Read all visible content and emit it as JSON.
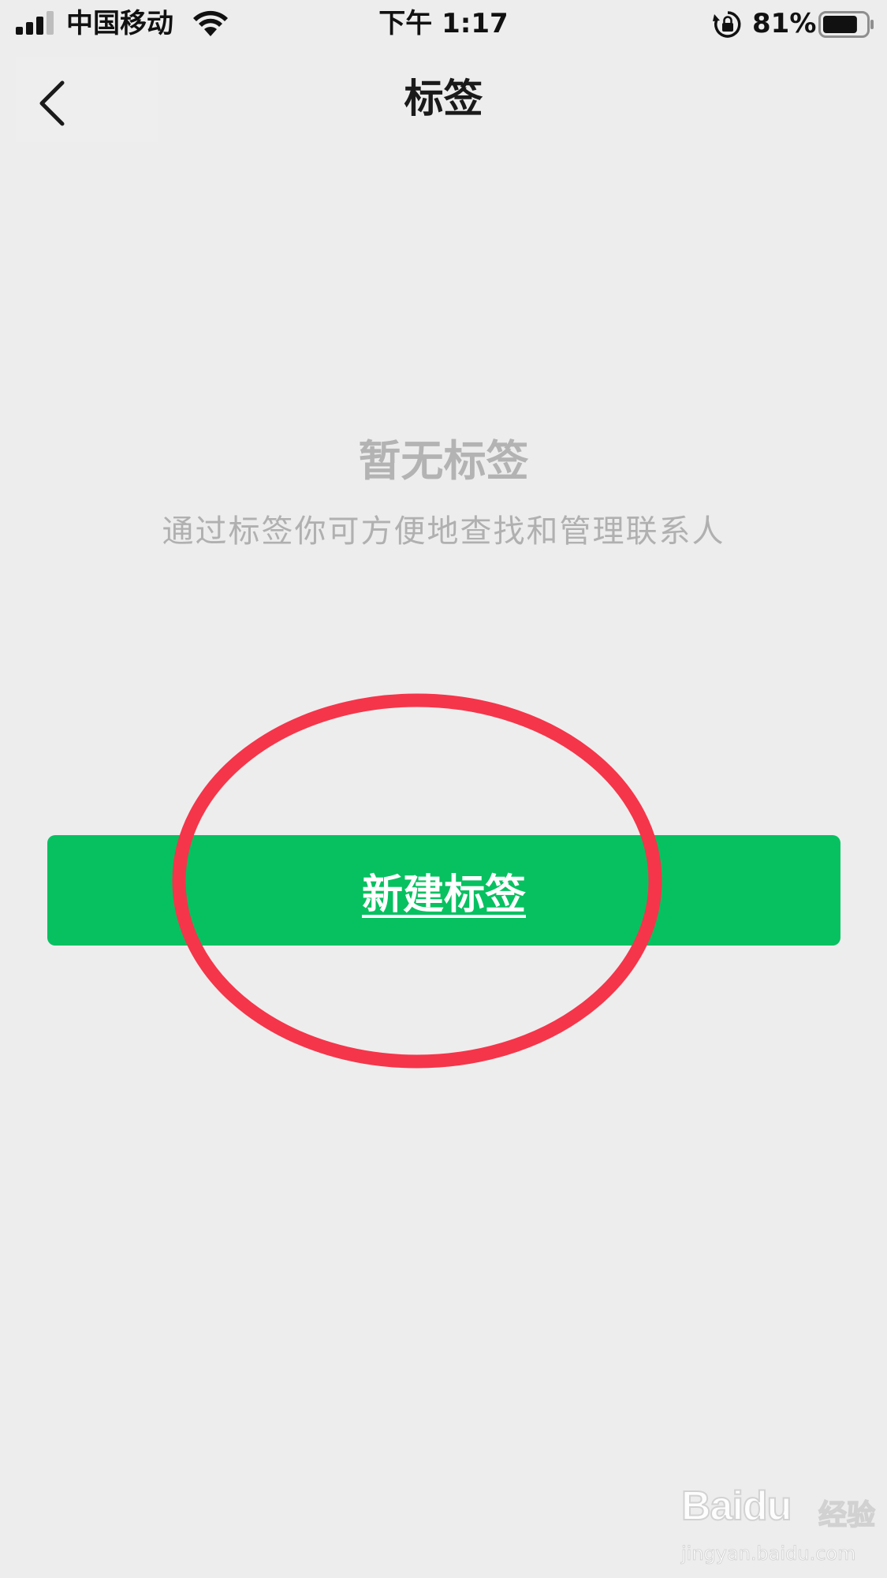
{
  "status_bar": {
    "carrier": "中国移动",
    "time": "下午 1:17",
    "battery_percent": "81%",
    "battery_level": 0.81,
    "signal_icon": "signal-bars-icon",
    "wifi_icon": "wifi-icon",
    "orientation_lock_icon": "orientation-lock-icon",
    "battery_icon": "battery-icon"
  },
  "nav": {
    "title": "标签",
    "back_icon": "chevron-left-icon"
  },
  "empty_state": {
    "title": "暂无标签",
    "description": "通过标签你可方便地查找和管理联系人"
  },
  "actions": {
    "new_tag_label": "新建标签"
  },
  "annotation": {
    "shape": "ellipse",
    "color": "#f5354a"
  },
  "watermark": {
    "logo": "Baidu",
    "brand": "经验",
    "url": "jingyan.baidu.com"
  },
  "colors": {
    "background": "#ededed",
    "primary_green": "#07c160",
    "muted_text": "#b0b0b0",
    "annotation_red": "#f5354a"
  }
}
